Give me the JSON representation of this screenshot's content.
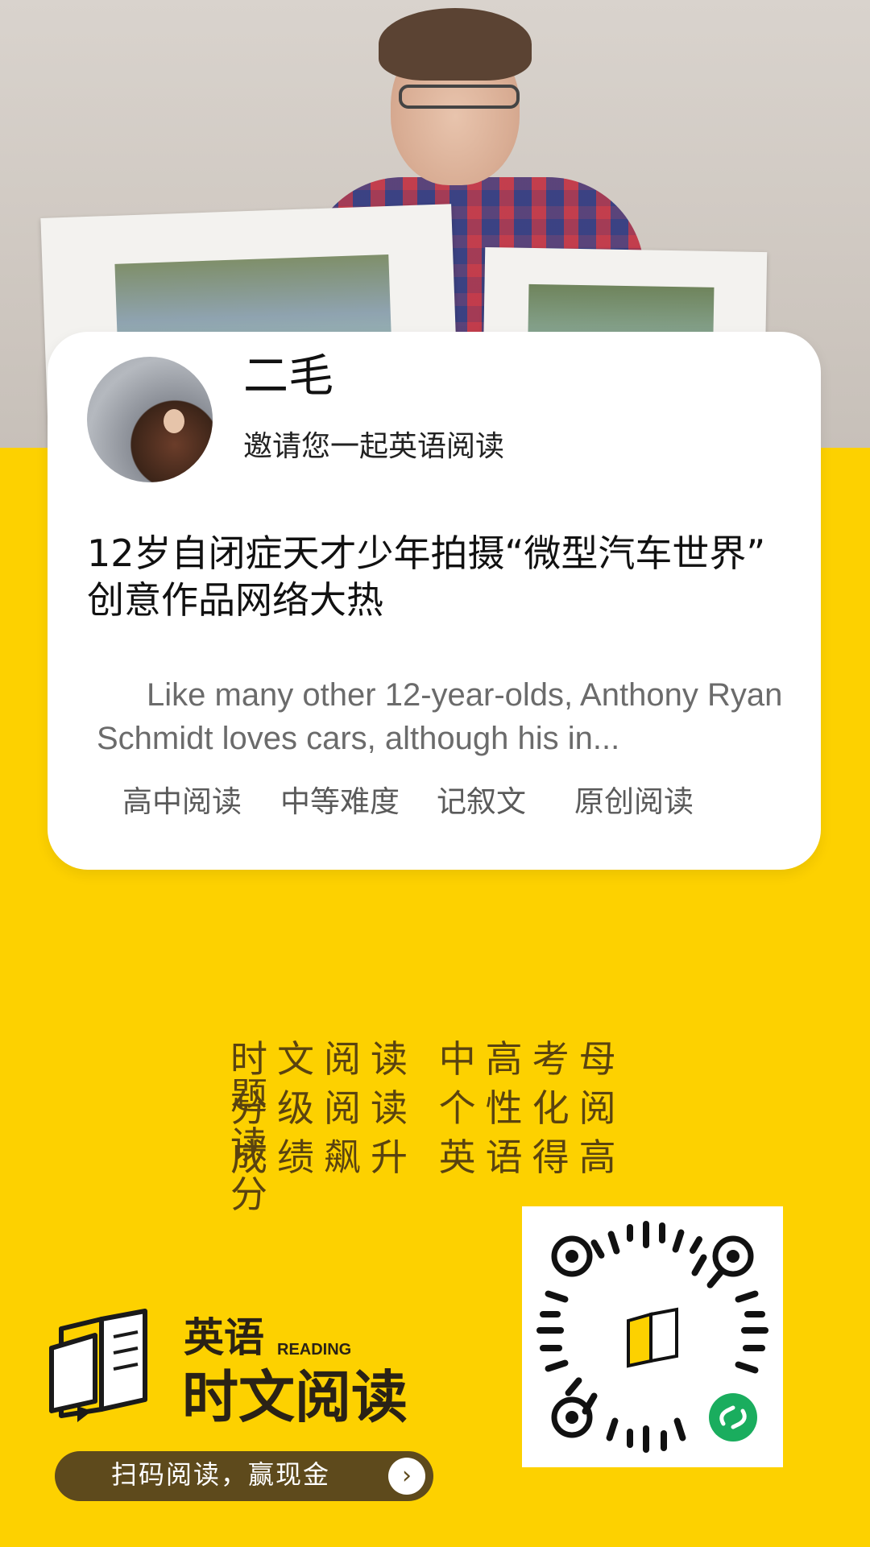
{
  "card": {
    "name": "二毛",
    "invite": "邀请您一起英语阅读",
    "headline": "12岁自闭症天才少年拍摄“微型汽车世界” 创意作品网络大热",
    "excerpt": "Like many other 12-year-olds, Anthony Ryan Schmidt loves cars, although his in...",
    "tags": [
      "高中阅读",
      "中等难度",
      "记叙文",
      "原创阅读"
    ]
  },
  "slogan": {
    "line1": "时文阅读 中高考母题",
    "line2": "分级阅读 个性化阅读",
    "line3": "成绩飙升 英语得高分"
  },
  "logo": {
    "small_text": "英语",
    "reading_text": "READING",
    "big_text": "时文阅读"
  },
  "scan_button": {
    "label": "扫码阅读，赢现金",
    "arrow": "›"
  },
  "icons": [
    "book-logo-icon",
    "chevron-right-icon",
    "miniprogram-icon"
  ],
  "colors": {
    "background": "#FDD100",
    "button": "#5e4a1c",
    "qr_badge": "#1aad5e"
  }
}
